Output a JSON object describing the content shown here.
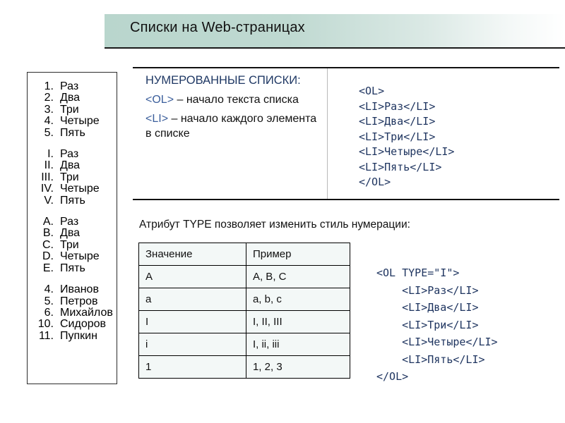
{
  "slide": {
    "title": "Списки на Web-страницах",
    "accent_banner_color": "#b9d6cd",
    "tag_color": "#3c5f9c",
    "code_color": "#1f3560",
    "heading_color": "#1f3864"
  },
  "sidebar": {
    "groups": [
      {
        "name": "decimal-list",
        "items": [
          {
            "marker": "1.",
            "label": "Раз"
          },
          {
            "marker": "2.",
            "label": "Два"
          },
          {
            "marker": "3.",
            "label": "Три"
          },
          {
            "marker": "4.",
            "label": "Четыре"
          },
          {
            "marker": "5.",
            "label": "Пять"
          }
        ]
      },
      {
        "name": "upper-roman-list",
        "items": [
          {
            "marker": "I.",
            "label": "Раз"
          },
          {
            "marker": "II.",
            "label": "Два"
          },
          {
            "marker": "III.",
            "label": "Три"
          },
          {
            "marker": "IV.",
            "label": "Четыре"
          },
          {
            "marker": "V.",
            "label": "Пять"
          }
        ]
      },
      {
        "name": "upper-alpha-list",
        "items": [
          {
            "marker": "A.",
            "label": "Раз"
          },
          {
            "marker": "B.",
            "label": "Два"
          },
          {
            "marker": "C.",
            "label": "Три"
          },
          {
            "marker": "D.",
            "label": "Четыре"
          },
          {
            "marker": "E.",
            "label": "Пять"
          }
        ]
      },
      {
        "name": "custom-start-list",
        "items": [
          {
            "marker": "4.",
            "label": "Иванов"
          },
          {
            "marker": "5.",
            "label": "Петров"
          },
          {
            "marker": "6.",
            "label": "Михайлов"
          },
          {
            "marker": "10.",
            "label": "Сидоров"
          },
          {
            "marker": "11.",
            "label": "Пупкин"
          }
        ]
      }
    ]
  },
  "explanation": {
    "heading": "НУМЕРОВАННЫЕ СПИСКИ:",
    "items": [
      {
        "tag": "<OL>",
        "text": " – начало текста списка"
      },
      {
        "tag": "<LI>",
        "text": " – начало каждого элемента в списке"
      }
    ]
  },
  "code_top": "<OL>\n<LI>Раз</LI>\n<LI>Два</LI>\n<LI>Три</LI>\n<LI>Четыре</LI>\n<LI>Пять</LI>\n</OL>",
  "attribute_note": "Атрибут TYPE позволяет изменить стиль нумерации:",
  "type_table": {
    "headers": [
      "Значение",
      "Пример"
    ],
    "rows": [
      [
        "A",
        "A, B, C"
      ],
      [
        "a",
        "a, b, c"
      ],
      [
        "I",
        "I, II, III"
      ],
      [
        "i",
        "I, ii, iii"
      ],
      [
        "1",
        "1, 2, 3"
      ]
    ]
  },
  "code_bottom": "<OL TYPE=\"I\">\n    <LI>Раз</LI>\n    <LI>Два</LI>\n    <LI>Три</LI>\n    <LI>Четыре</LI>\n    <LI>Пять</LI>\n</OL>"
}
